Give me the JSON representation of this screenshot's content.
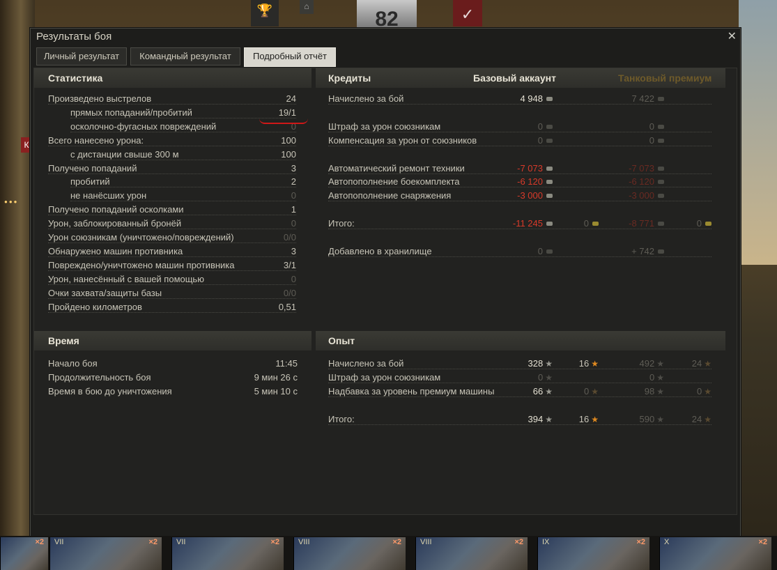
{
  "window": {
    "title": "Результаты боя",
    "close_glyph": "✕"
  },
  "hud": {
    "battle_number": "82",
    "check_glyph": "✓",
    "cup_glyph": "🏆",
    "tag_glyph": "⌂"
  },
  "tabs": [
    {
      "label": "Личный результат",
      "active": false
    },
    {
      "label": "Командный результат",
      "active": false
    },
    {
      "label": "Подробный отчёт",
      "active": true
    }
  ],
  "statistics": {
    "header": "Статистика",
    "rows": [
      {
        "label": "Произведено выстрелов",
        "value": "24",
        "indent": false,
        "dim": false
      },
      {
        "label": "прямых попаданий/пробитий",
        "value": "19/1",
        "indent": true,
        "dim": false
      },
      {
        "label": "осколочно-фугасных повреждений",
        "value": "0",
        "indent": true,
        "dim": true
      },
      {
        "label": "Всего нанесено урона:",
        "value": "100",
        "indent": false,
        "dim": false
      },
      {
        "label": "с дистанции свыше 300 м",
        "value": "100",
        "indent": true,
        "dim": false
      },
      {
        "label": "Получено попаданий",
        "value": "3",
        "indent": false,
        "dim": false
      },
      {
        "label": "пробитий",
        "value": "2",
        "indent": true,
        "dim": false
      },
      {
        "label": "не нанёсших урон",
        "value": "0",
        "indent": true,
        "dim": true
      },
      {
        "label": "Получено попаданий осколками",
        "value": "1",
        "indent": false,
        "dim": false
      },
      {
        "label": "Урон, заблокированный бронёй",
        "value": "0",
        "indent": false,
        "dim": true
      },
      {
        "label": "Урон союзникам (уничтожено/повреждений)",
        "value": "0/0",
        "indent": false,
        "dim": true
      },
      {
        "label": "Обнаружено машин противника",
        "value": "3",
        "indent": false,
        "dim": false
      },
      {
        "label": "Повреждено/уничтожено машин противника",
        "value": "3/1",
        "indent": false,
        "dim": false
      },
      {
        "label": "Урон, нанесённый с вашей помощью",
        "value": "0",
        "indent": false,
        "dim": true
      },
      {
        "label": "Очки захвата/защиты базы",
        "value": "0/0",
        "indent": false,
        "dim": true
      },
      {
        "label": "Пройдено километров",
        "value": "0,51",
        "indent": false,
        "dim": false
      }
    ]
  },
  "time": {
    "header": "Время",
    "rows": [
      {
        "label": "Начало боя",
        "value": "11:45"
      },
      {
        "label": "Продолжительность боя",
        "value": "9 мин 26 с"
      },
      {
        "label": "Время в бою до уничтожения",
        "value": "5 мин 10 с"
      }
    ]
  },
  "credits": {
    "header": "Кредиты",
    "col_base": "Базовый аккаунт",
    "col_premium": "Танковый премиум",
    "rows": [
      {
        "label": "Начислено за бой",
        "base": "4 948",
        "base_gold": "",
        "prem": "7 422",
        "prem_gold": "",
        "type": "bright"
      },
      {
        "label": "",
        "base": "",
        "base_gold": "",
        "prem": "",
        "prem_gold": "",
        "type": "blank"
      },
      {
        "label": "Штраф за урон союзникам",
        "base": "0",
        "base_gold": "",
        "prem": "0",
        "prem_gold": "",
        "type": "dim"
      },
      {
        "label": "Компенсация за урон от союзников",
        "base": "0",
        "base_gold": "",
        "prem": "0",
        "prem_gold": "",
        "type": "dim"
      },
      {
        "label": "",
        "base": "",
        "base_gold": "",
        "prem": "",
        "prem_gold": "",
        "type": "blank"
      },
      {
        "label": "Автоматический ремонт техники",
        "base": "-7 073",
        "base_gold": "",
        "prem": "-7 073",
        "prem_gold": "",
        "type": "red"
      },
      {
        "label": "Автопополнение боекомплекта",
        "base": "-6 120",
        "base_gold": "",
        "prem": "-6 120",
        "prem_gold": "",
        "type": "red"
      },
      {
        "label": "Автопополнение снаряжения",
        "base": "-3 000",
        "base_gold": "",
        "prem": "-3 000",
        "prem_gold": "",
        "type": "red"
      },
      {
        "label": "",
        "base": "",
        "base_gold": "",
        "prem": "",
        "prem_gold": "",
        "type": "blank"
      },
      {
        "label": "Итого:",
        "base": "-11 245",
        "base_gold": "0",
        "prem": "-8 771",
        "prem_gold": "0",
        "type": "total"
      },
      {
        "label": "",
        "base": "",
        "base_gold": "",
        "prem": "",
        "prem_gold": "",
        "type": "blank"
      },
      {
        "label": "Добавлено в хранилище",
        "base": "0",
        "base_gold": "",
        "prem": "+ 742",
        "prem_gold": "",
        "type": "dim"
      }
    ]
  },
  "experience": {
    "header": "Опыт",
    "rows": [
      {
        "label": "Начислено за бой",
        "base": "328",
        "base_free": "16",
        "prem": "492",
        "prem_free": "24",
        "base_dim": false,
        "free_dim": false
      },
      {
        "label": "Штраф за урон союзникам",
        "base": "0",
        "base_free": "",
        "prem": "0",
        "prem_free": "",
        "base_dim": true,
        "free_dim": true
      },
      {
        "label": "Надбавка за уровень премиум машины",
        "base": "66",
        "base_free": "0",
        "prem": "98",
        "prem_free": "0",
        "base_dim": false,
        "free_dim": true
      },
      {
        "label": "",
        "base": "",
        "base_free": "",
        "prem": "",
        "prem_free": "",
        "base_dim": true,
        "free_dim": true
      },
      {
        "label": "Итого:",
        "base": "394",
        "base_free": "16",
        "prem": "590",
        "prem_free": "24",
        "base_dim": false,
        "free_dim": false
      }
    ]
  },
  "vehicles": [
    {
      "tier": "VII",
      "mult": "×2"
    },
    {
      "tier": "VII",
      "mult": "×2"
    },
    {
      "tier": "VIII",
      "mult": "×2"
    },
    {
      "tier": "VIII",
      "mult": "×2"
    },
    {
      "tier": "IX",
      "mult": "×2"
    },
    {
      "tier": "X",
      "mult": "×2"
    }
  ],
  "side_label": "К",
  "first_vehicle_mult": "×2"
}
